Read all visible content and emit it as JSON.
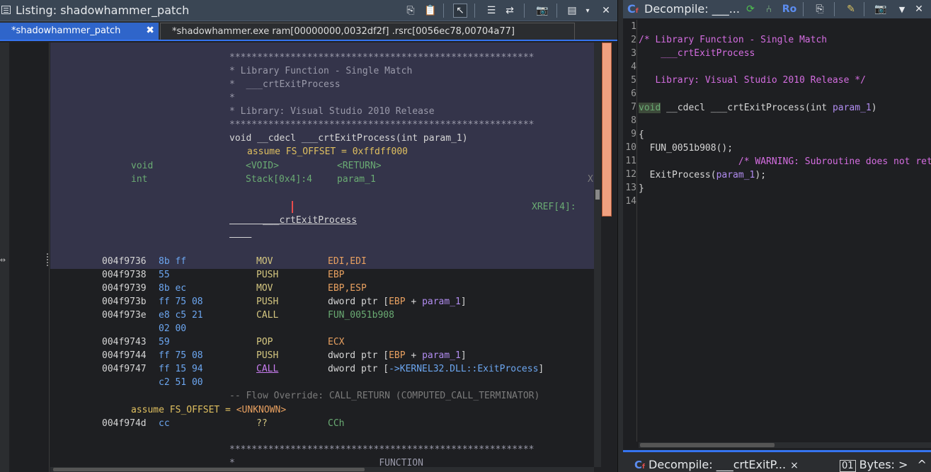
{
  "listing": {
    "title": "Listing:  shadowhammer_patch",
    "tabs": [
      {
        "label": "*shadowhammer_patch",
        "close": "✖"
      },
      {
        "label": "*shadowhammer.exe ram[00000000,0032df2f] .rsrc[0056ec78,00704a77]"
      }
    ],
    "header": {
      "stars": "*******************************************************",
      "lib_line": "* Library Function - Single Match",
      "name_line": "*  ___crtExitProcess",
      "blank_line": "*",
      "lib2_line": "* Library: Visual Studio 2010 Release",
      "signature": "void __cdecl ___crtExitProcess(int param_1)",
      "assume": "assume FS_OFFSET = 0xffdff000",
      "ret_type": "void",
      "ret_storage": "<VOID>",
      "ret_name": "<RETURN>",
      "param_type": "int",
      "param_storage": "Stack[0x4]:4",
      "param_name": "param_1",
      "x_mark": "X",
      "label": "___crtExitProcess",
      "xref": "XREF[4]:"
    },
    "instructions": [
      {
        "addr": "004f9736",
        "bytes": "8b ff",
        "mnem": "MOV",
        "ops": "EDI,EDI"
      },
      {
        "addr": "004f9738",
        "bytes": "55",
        "mnem": "PUSH",
        "ops": "EBP"
      },
      {
        "addr": "004f9739",
        "bytes": "8b ec",
        "mnem": "MOV",
        "ops": "EBP,ESP"
      },
      {
        "addr": "004f973b",
        "bytes": "ff 75 08",
        "mnem": "PUSH",
        "ops_pre": "dword ptr [",
        "ops_reg": "EBP",
        "ops_mid": " + ",
        "ops_param": "param_1",
        "ops_post": "]"
      },
      {
        "addr": "004f973e",
        "bytes": "e8 c5 21",
        "mnem": "CALL",
        "ops": "FUN_0051b908"
      },
      {
        "addr": "",
        "bytes": "02 00",
        "mnem": "",
        "ops": ""
      },
      {
        "addr": "004f9743",
        "bytes": "59",
        "mnem": "POP",
        "ops": "ECX"
      },
      {
        "addr": "004f9744",
        "bytes": "ff 75 08",
        "mnem": "PUSH",
        "ops_pre": "dword ptr [",
        "ops_reg": "EBP",
        "ops_mid": " + ",
        "ops_param": "param_1",
        "ops_post": "]"
      },
      {
        "addr": "004f9747",
        "bytes": "ff 15 94",
        "mnem": "CALL",
        "ops_pre": "dword ptr [",
        "ops_link": "->KERNEL32.DLL::ExitProcess",
        "ops_post": "]"
      },
      {
        "addr": "",
        "bytes": "c2 51 00",
        "mnem": "",
        "ops": ""
      }
    ],
    "flow_override": "-- Flow Override: CALL_RETURN (COMPUTED_CALL_TERMINATOR)",
    "assume_unknown_pre": "assume FS_OFFSET = ",
    "assume_unknown_val": "<UNKNOWN>",
    "last_instr": {
      "addr": "004f974d",
      "bytes": "cc",
      "mnem": "??",
      "ops": "CCh"
    },
    "footer_stars": "*******************************************************",
    "footer_function": "*                          FUNCTION"
  },
  "decompile": {
    "title": "Decompile: ___...",
    "ro_label": "Ro",
    "line_numbers": [
      "1",
      "2",
      "3",
      "4",
      "5",
      "6",
      "7",
      "8",
      "9",
      "10",
      "11",
      "12",
      "13",
      "14"
    ],
    "code": {
      "l2": "/* Library Function - Single Match",
      "l3": "    ___crtExitProcess",
      "l5": "   Library: Visual Studio 2010 Release */",
      "l7_type": "void",
      "l7_rest": " __cdecl ___crtExitProcess(int ",
      "l7_param": "param_1",
      "l7_end": ")",
      "l9": "{",
      "l10": "  FUN_0051b908();",
      "l11": "                  /* WARNING: Subroutine does not return */",
      "l12_pre": "  ExitProcess(",
      "l12_param": "param_1",
      "l12_end": ");",
      "l13": "}"
    },
    "bottom_tab": "Decompile: ___crtExitP...",
    "bottom_tab_close": "×",
    "bytes_tab": "Bytes: >"
  }
}
